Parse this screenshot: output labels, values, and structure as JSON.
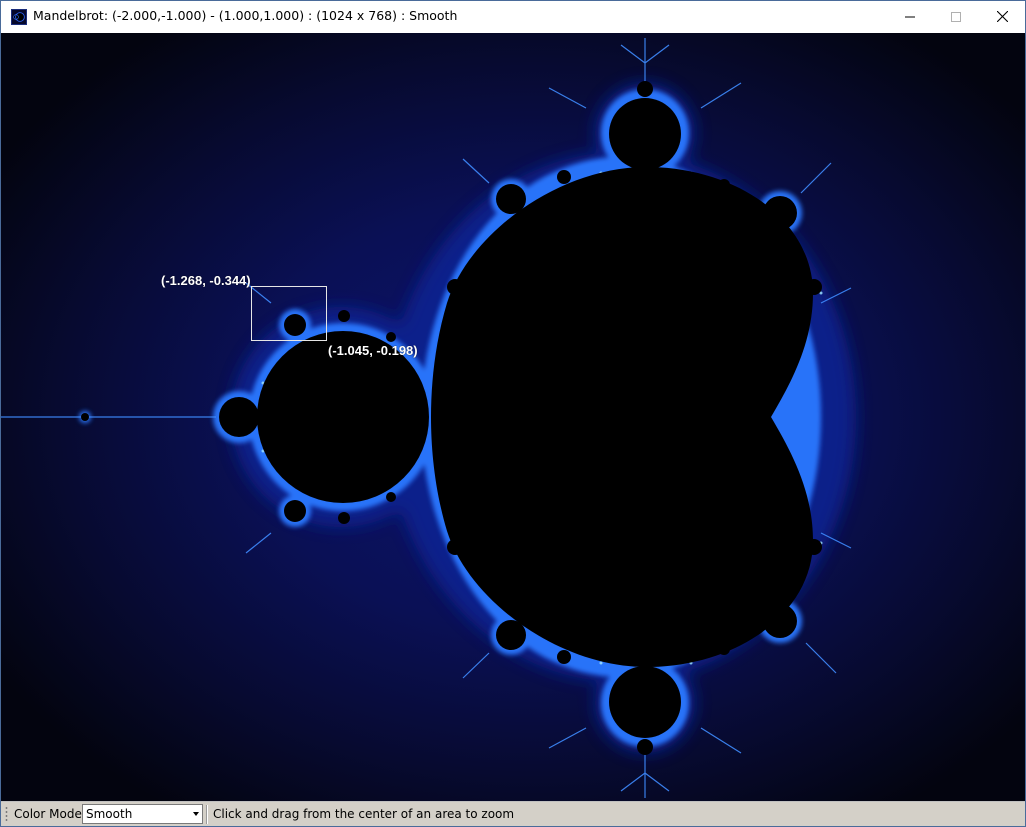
{
  "window": {
    "title": "Mandelbrot: (-2.000,-1.000) - (1.000,1.000) : (1024 x 768) : Smooth",
    "app_icon": "mandelbrot-app-icon",
    "controls": {
      "minimize_icon": "minimize-icon",
      "maximize_icon": "maximize-icon",
      "close_icon": "close-icon"
    }
  },
  "canvas": {
    "colors": {
      "background_dark": "#050510",
      "glow_blue": "#0c1260",
      "edge_blue": "#1e6cff",
      "edge_cyan": "#7fd0ff",
      "set_color": "#000000"
    },
    "selection": {
      "top_left_label": "(-1.268, -0.344)",
      "bottom_right_label": "(-1.045, -0.198)"
    }
  },
  "toolbar": {
    "color_mode_label": "Color Mode",
    "color_mode_value": "Smooth",
    "status_text": "Click and drag from the center of an area to zoom"
  }
}
